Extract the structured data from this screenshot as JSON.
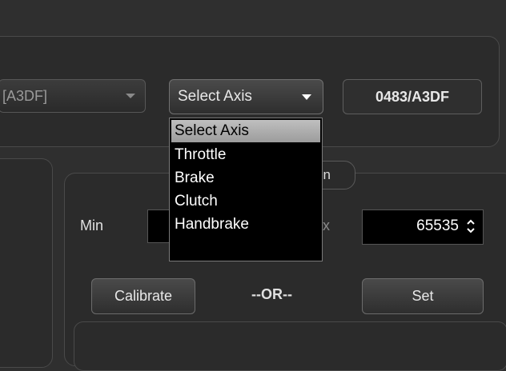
{
  "device_row": {
    "device_combo_text": "[A3DF]",
    "axis_combo_value": "Select Axis",
    "id_badge": "0483/A3DF"
  },
  "axis_dropdown": {
    "options": [
      "Select Axis",
      "Throttle",
      "Brake",
      "Clutch",
      "Handbrake"
    ],
    "selected_index": 0
  },
  "tab_fragment": "n",
  "range": {
    "min_label": "Min",
    "max_label_fragment": "x",
    "max_value": "65535"
  },
  "actions": {
    "calibrate_label": "Calibrate",
    "or_label": "--OR--",
    "set_label": "Set"
  }
}
